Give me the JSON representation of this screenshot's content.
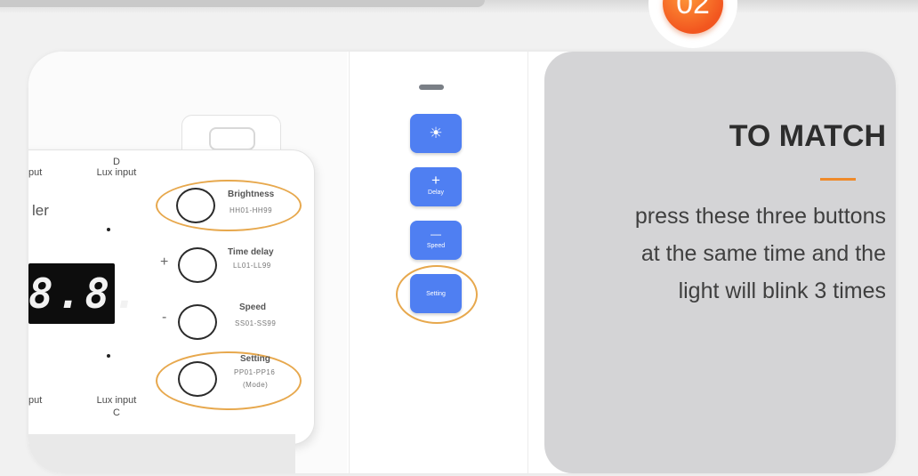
{
  "step": {
    "number": "02",
    "color": "#f36a22"
  },
  "instruction": {
    "title": "TO MATCH",
    "lines": [
      "press these three buttons",
      "at the same time and the",
      "light will blink 3 times"
    ],
    "accent_color": "#ef8a2a"
  },
  "controller": {
    "partial_label_top": "put",
    "partial_label_bottom": "put",
    "partial_name": "ler",
    "port_d": {
      "letter": "D",
      "label": "Lux input"
    },
    "port_c": {
      "label": "Lux input",
      "letter": "C"
    },
    "display": "8.8.",
    "buttons": [
      {
        "title": "Brightness",
        "range": "HH01-HH99",
        "sign": ""
      },
      {
        "title": "Time delay",
        "range": "LL01-LL99",
        "sign": "+"
      },
      {
        "title": "Speed",
        "range": "SS01-SS99",
        "sign": "-"
      },
      {
        "title": "Setting",
        "range": "PP01-PP16",
        "extra": "(Mode)",
        "sign": ""
      }
    ],
    "highlight_color": "#e7a84d"
  },
  "remote": {
    "button_color": "#4f7ff2",
    "buttons": [
      {
        "symbol": "☀",
        "label": ""
      },
      {
        "symbol": "+",
        "label": "Delay"
      },
      {
        "symbol": "—",
        "label": "Speed"
      },
      {
        "symbol": "",
        "label": "Setting"
      }
    ]
  }
}
